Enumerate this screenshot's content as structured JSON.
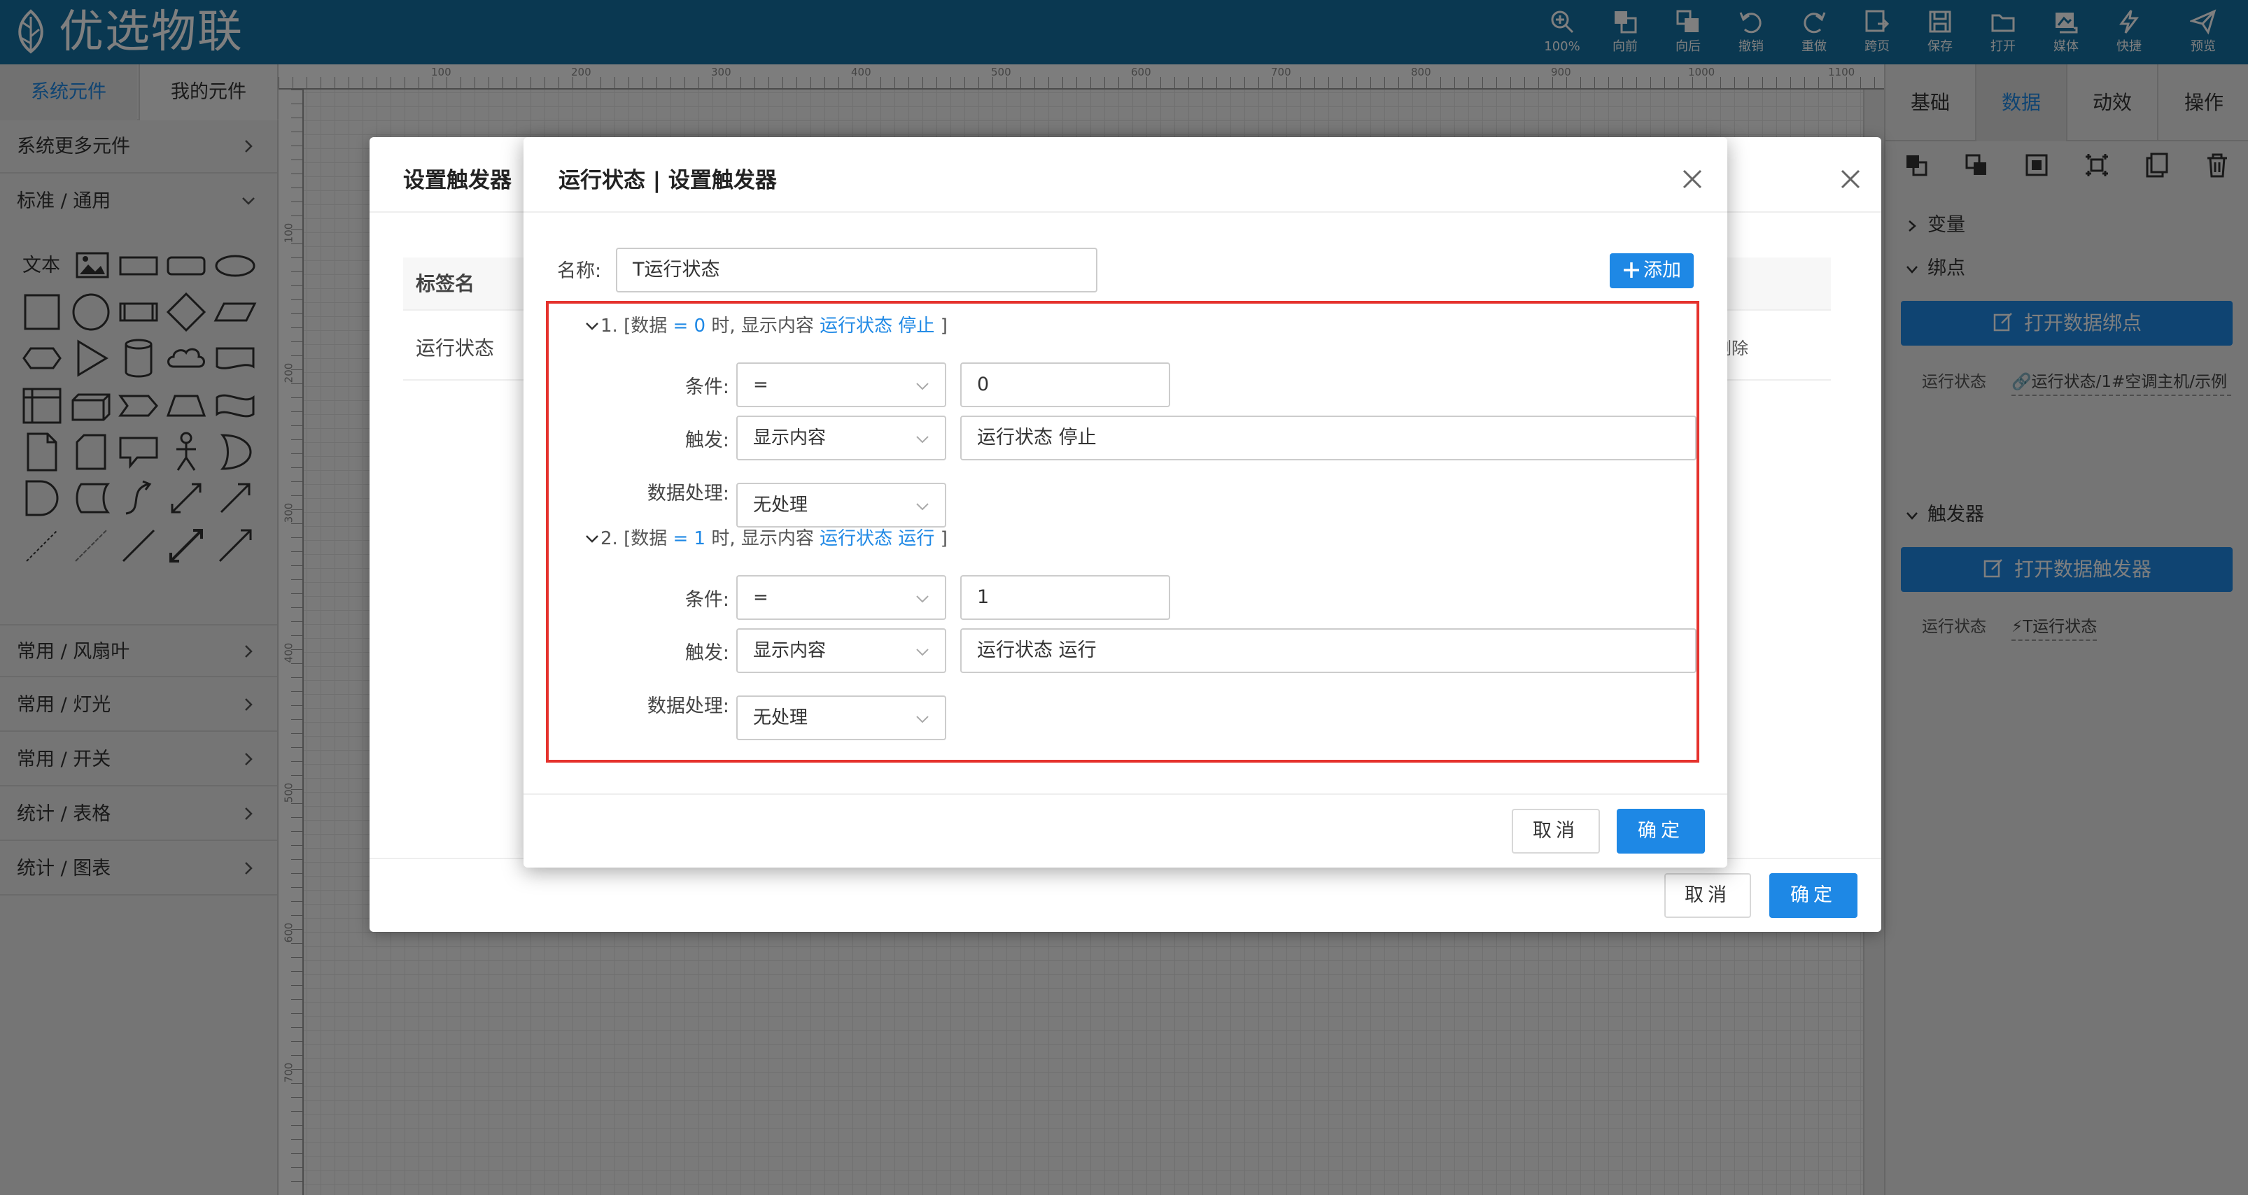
{
  "app": {
    "brand": "优选物联",
    "toolbar": [
      {
        "label": "100%",
        "icon": "zoom-in-icon"
      },
      {
        "label": "向前",
        "icon": "bring-forward-icon"
      },
      {
        "label": "向后",
        "icon": "send-backward-icon"
      },
      {
        "label": "撤销",
        "icon": "undo-icon"
      },
      {
        "label": "重做",
        "icon": "redo-icon"
      },
      {
        "label": "跨页",
        "icon": "cross-page-icon"
      },
      {
        "label": "保存",
        "icon": "save-icon"
      },
      {
        "label": "打开",
        "icon": "folder-open-icon"
      },
      {
        "label": "媒体",
        "icon": "media-icon"
      },
      {
        "label": "快捷",
        "icon": "lightning-icon"
      },
      {
        "label": "预览",
        "icon": "paper-plane-icon"
      }
    ]
  },
  "left_panel": {
    "tabs": [
      "系统元件",
      "我的元件"
    ],
    "sections": [
      {
        "label": "系统更多元件",
        "state": "collapsed"
      },
      {
        "label": "标准 / 通用",
        "state": "expanded"
      },
      {
        "label": "常用 / 风扇叶",
        "state": "collapsed"
      },
      {
        "label": "常用 / 灯光",
        "state": "collapsed"
      },
      {
        "label": "常用 / 开关",
        "state": "collapsed"
      },
      {
        "label": "统计 / 表格",
        "state": "collapsed"
      },
      {
        "label": "统计 / 图表",
        "state": "collapsed"
      }
    ],
    "text_shape_label": "文本"
  },
  "rulers": {
    "horizontal": [
      "100",
      "200",
      "300",
      "400",
      "500",
      "600",
      "700",
      "800",
      "900",
      "1000",
      "1100"
    ],
    "vertical": [
      "100",
      "200",
      "300",
      "400",
      "500",
      "600",
      "700"
    ]
  },
  "right_panel": {
    "tabs": [
      "基础",
      "数据",
      "动效",
      "操作"
    ],
    "active_tab": "数据",
    "sections": {
      "variable": "变量",
      "binding": "绑点",
      "trigger": "触发器"
    },
    "open_binding_button": "打开数据绑点",
    "open_trigger_button": "打开数据触发器",
    "binding_row": {
      "label": "运行状态",
      "value": "运行状态/1#空调主机/示例"
    },
    "trigger_row": {
      "label": "运行状态",
      "value": "T运行状态"
    }
  },
  "dialog_outer": {
    "title": "设置触发器",
    "table_header": "标签名",
    "row": {
      "name": "运行状态",
      "action": "删除"
    },
    "cancel": "取消",
    "confirm": "确定"
  },
  "dialog_inner": {
    "title": "运行状态 | 设置触发器",
    "name_label": "名称:",
    "name_value": "T运行状态",
    "add_button": "添加",
    "rules": [
      {
        "index": "1.",
        "summary_prefix": "[数据",
        "summary_cond": "= 0",
        "summary_mid": "时, 显示内容",
        "summary_value": "运行状态 停止",
        "summary_suffix": "]",
        "condition_label": "条件:",
        "condition_op": "=",
        "condition_value": "0",
        "trigger_label": "触发:",
        "trigger_type": "显示内容",
        "trigger_value": "运行状态 停止",
        "process_label": "数据处理:",
        "process_value": "无处理"
      },
      {
        "index": "2.",
        "summary_prefix": "[数据",
        "summary_cond": "= 1",
        "summary_mid": "时, 显示内容",
        "summary_value": "运行状态 运行",
        "summary_suffix": "]",
        "condition_label": "条件:",
        "condition_op": "=",
        "condition_value": "1",
        "trigger_label": "触发:",
        "trigger_type": "显示内容",
        "trigger_value": "运行状态 运行",
        "process_label": "数据处理:",
        "process_value": "无处理"
      }
    ],
    "cancel": "取消",
    "confirm": "确定"
  },
  "colors": {
    "primary": "#1e88e5",
    "topbar": "#1470a3",
    "highlight_border": "#e5322d"
  }
}
